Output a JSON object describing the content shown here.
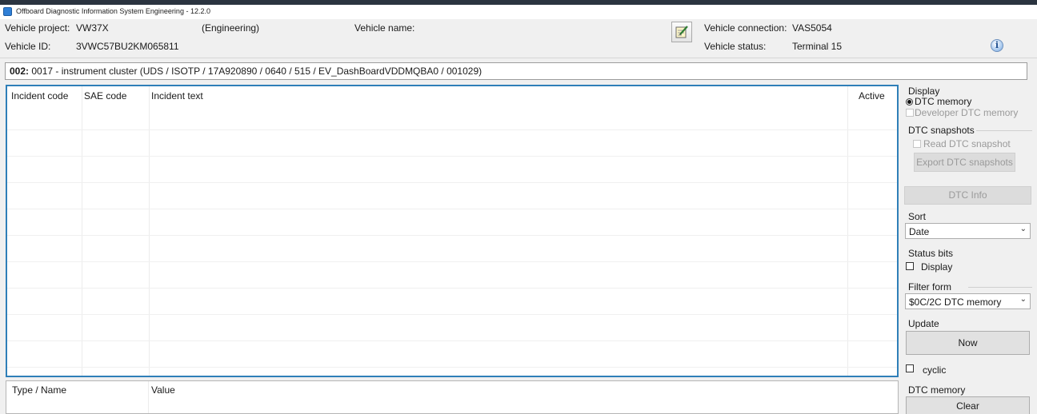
{
  "window": {
    "title": "Offboard Diagnostic Information System Engineering - 12.2.0"
  },
  "header": {
    "vehicle_project_label": "Vehicle project:",
    "vehicle_project_value": "VW37X",
    "vehicle_project_mode": "(Engineering)",
    "vehicle_name_label": "Vehicle name:",
    "vehicle_name_value": "",
    "vehicle_id_label": "Vehicle ID:",
    "vehicle_id_value": "3VWC57BU2KM065811",
    "vehicle_connection_label": "Vehicle connection:",
    "vehicle_connection_value": "VAS5054",
    "vehicle_status_label": "Vehicle status:",
    "vehicle_status_value": "Terminal 15",
    "edit_icon": "edit-notepad-icon",
    "info_icon": "info-icon"
  },
  "ecu": {
    "address": "002:",
    "description": "0017 - instrument cluster  (UDS / ISOTP / 17A920890 / 0640 / 515 / EV_DashBoardVDDMQBA0 / 001029)"
  },
  "dtc_table": {
    "columns": [
      "Incident code",
      "SAE code",
      "Incident text",
      "Active"
    ],
    "rows": []
  },
  "detail_table": {
    "columns": [
      "Type / Name",
      "Value"
    ],
    "rows": []
  },
  "sidebar": {
    "display": {
      "label": "Display",
      "dtc_memory": "DTC memory",
      "developer_dtc_memory": "Developer DTC memory",
      "selected": "DTC memory"
    },
    "snapshots": {
      "label": "DTC snapshots",
      "read_snapshot": "Read DTC snapshot",
      "export_button": "Export DTC snapshots"
    },
    "dtc_info_button": "DTC Info",
    "sort": {
      "label": "Sort",
      "value": "Date"
    },
    "status_bits": {
      "label": "Status bits",
      "display": "Display",
      "checked": false
    },
    "filter_form": {
      "label": "Filter form",
      "value": "$0C/2C DTC memory"
    },
    "update": {
      "label": "Update",
      "now_button": "Now",
      "cyclic": "cyclic",
      "cyclic_checked": false
    },
    "dtc_memory": {
      "label": "DTC memory",
      "clear_button": "Clear"
    }
  },
  "colors": {
    "table_focus_border": "#2f7fb8",
    "accent": "#2f7fd6"
  }
}
